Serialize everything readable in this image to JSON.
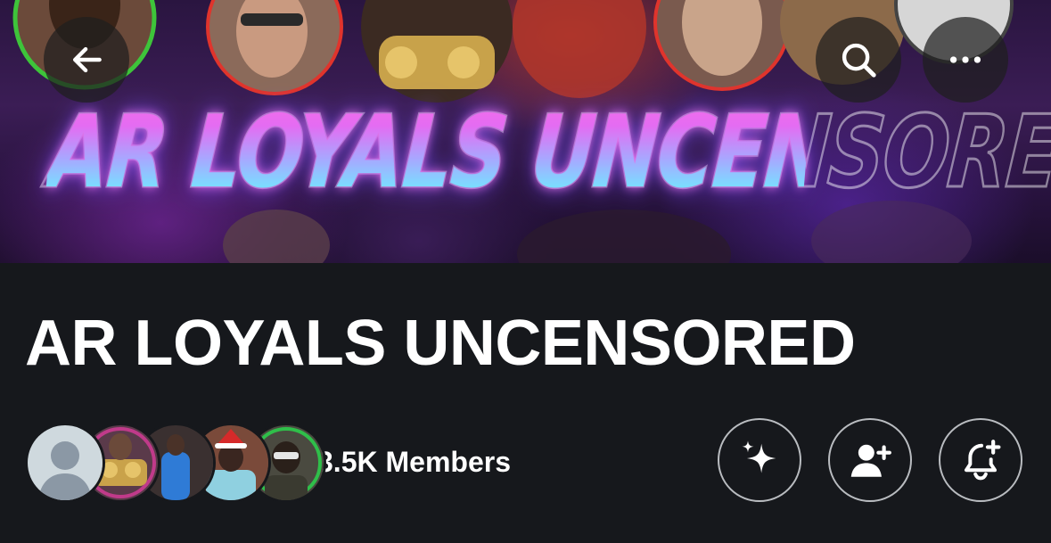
{
  "banner": {
    "artwork_text": "AR LOYALS UNCENSORED"
  },
  "toolbar": {
    "back_icon": "arrow-left-icon",
    "search_icon": "search-icon",
    "more_icon": "more-horizontal-icon"
  },
  "community": {
    "title": "AR LOYALS UNCENSORED",
    "members_label": "3.5K Members"
  },
  "actions": {
    "sparkle_icon": "sparkle-icon",
    "follow_icon": "person-add-icon",
    "notify_icon": "bell-add-icon"
  },
  "colors": {
    "background": "#16181c",
    "text": "#ffffff",
    "button_border": "#b9bcc0",
    "banner_pink": "#ff6ee6",
    "banner_blue": "#62b8ff"
  }
}
